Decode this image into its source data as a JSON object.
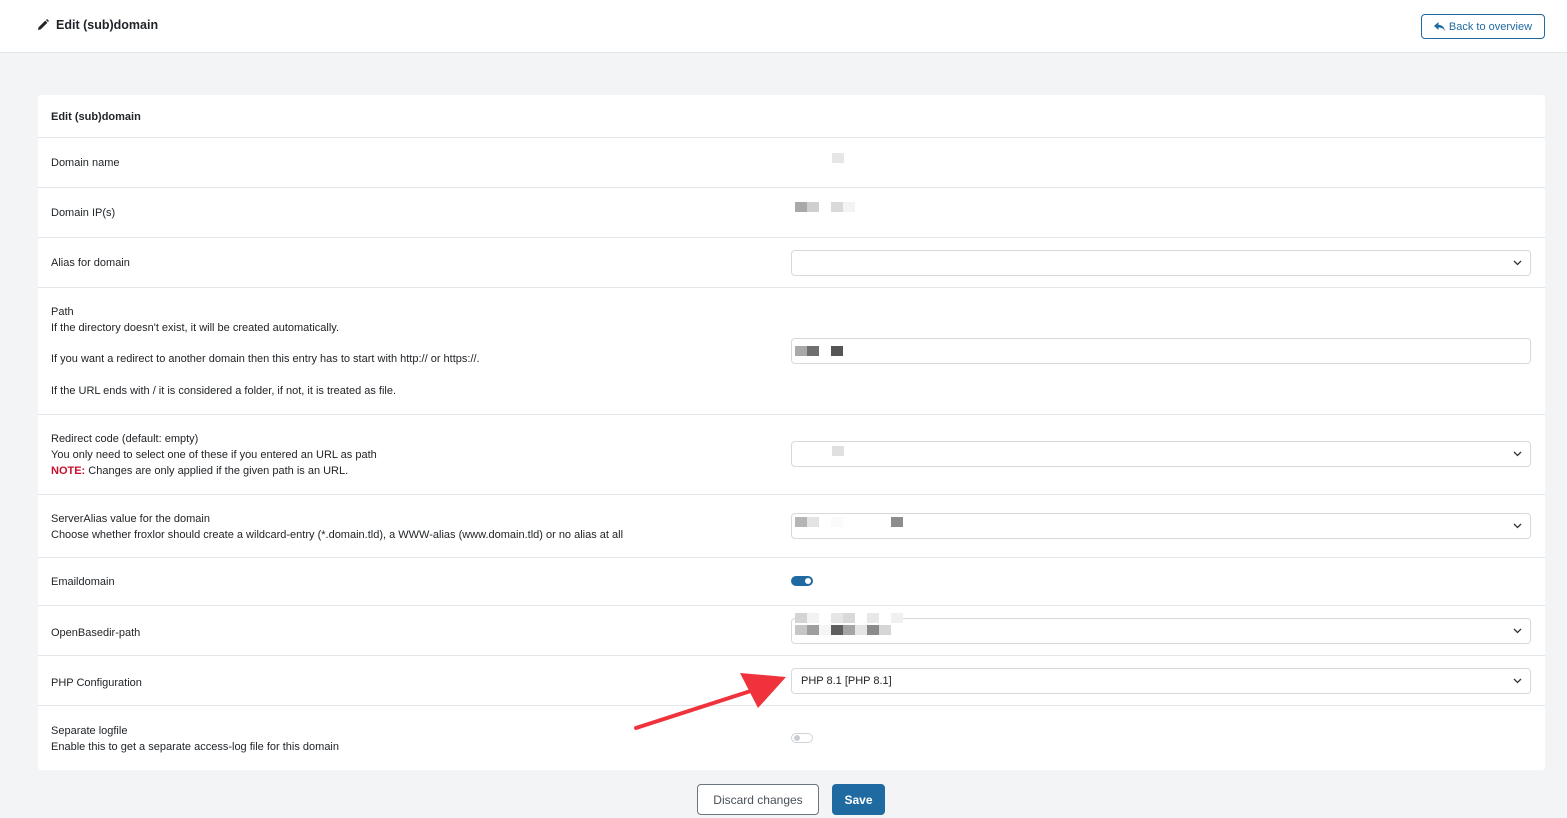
{
  "header": {
    "title": "Edit (sub)domain",
    "back_button": "Back to overview"
  },
  "card": {
    "title": "Edit (sub)domain"
  },
  "fields": {
    "domain_name": {
      "label": "Domain name"
    },
    "domain_ips": {
      "label": "Domain IP(s)"
    },
    "alias": {
      "label": "Alias for domain"
    },
    "path": {
      "label": "Path",
      "help1": "If the directory doesn't exist, it will be created automatically.",
      "help2": "If you want a redirect to another domain then this entry has to start with http:// or https://.",
      "help3": "If the URL ends with / it is considered a folder, if not, it is treated as file."
    },
    "redirect": {
      "label": "Redirect code (default: empty)",
      "help1": "You only need to select one of these if you entered an URL as path",
      "note_label": "NOTE:",
      "note_text": " Changes are only applied if the given path is an URL."
    },
    "serveralias": {
      "label": "ServerAlias value for the domain",
      "help": "Choose whether froxlor should create a wildcard-entry (*.domain.tld), a WWW-alias (www.domain.tld) or no alias at all"
    },
    "emaildomain": {
      "label": "Emaildomain",
      "enabled": true
    },
    "openbasedir": {
      "label": "OpenBasedir-path"
    },
    "php_config": {
      "label": "PHP Configuration",
      "value": "PHP 8.1 [PHP 8.1]"
    },
    "logfile": {
      "label": "Separate logfile",
      "help": "Enable this to get a separate access-log file for this domain",
      "enabled": false
    }
  },
  "actions": {
    "discard": "Discard changes",
    "save": "Save"
  },
  "colors": {
    "primary": "#1f6aa1",
    "note": "#c8102e",
    "annotation_arrow": "#f0323c"
  }
}
